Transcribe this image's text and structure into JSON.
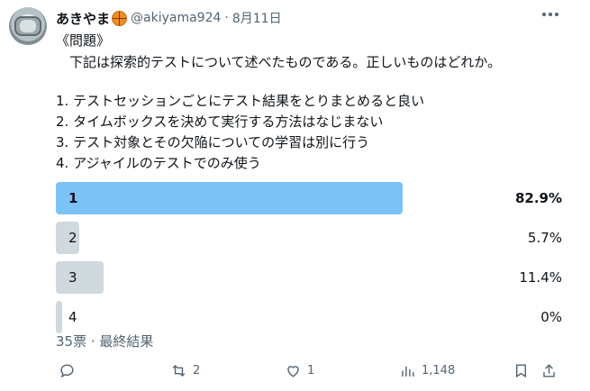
{
  "tweet": {
    "author_name": "あきやま",
    "handle": "@akiyama924",
    "separator": "·",
    "date": "8月11日",
    "lines": [
      "《問題》",
      "　下記は探索的テストについて述べたものである。正しいものはどれか。",
      "",
      "1.  テストセッションごとにテスト結果をとりまとめると良い",
      "2.  タイムボックスを決めて実行する方法はなじまない",
      "3.  テスト対象とその欠陥についての学習は別に行う",
      "4.  アジャイルのテストでのみ使う"
    ]
  },
  "poll": {
    "options": [
      {
        "label": "1",
        "percent_text": "82.9%",
        "fraction": 0.829,
        "winner": true
      },
      {
        "label": "2",
        "percent_text": "5.7%",
        "fraction": 0.057,
        "winner": false
      },
      {
        "label": "3",
        "percent_text": "11.4%",
        "fraction": 0.114,
        "winner": false
      },
      {
        "label": "4",
        "percent_text": "0%",
        "fraction": 0.0,
        "winner": false
      }
    ],
    "meta": "35票 · 最終結果",
    "colors": {
      "winner": "#7bc3f7",
      "other": "#cfd9de"
    }
  },
  "actions": {
    "reply_count": "",
    "retweet_count": "2",
    "like_count": "1",
    "view_count": "1,148"
  },
  "icons": [
    "more-icon",
    "reply-icon",
    "retweet-icon",
    "like-icon",
    "views-icon",
    "bookmark-icon",
    "share-icon"
  ]
}
